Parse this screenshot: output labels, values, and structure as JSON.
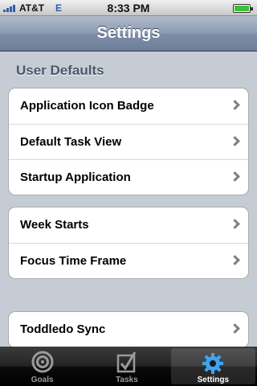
{
  "status": {
    "carrier": "AT&T",
    "network": "E",
    "time": "8:33 PM"
  },
  "nav": {
    "title": "Settings"
  },
  "sections": [
    {
      "header": "User Defaults",
      "rows": [
        "Application Icon Badge",
        "Default Task View",
        "Startup Application"
      ]
    },
    {
      "rows": [
        "Week Starts",
        "Focus Time Frame"
      ]
    },
    {
      "rows": [
        "Toddledo Sync"
      ]
    }
  ],
  "tabs": [
    {
      "label": "Goals",
      "icon": "target-icon"
    },
    {
      "label": "Tasks",
      "icon": "checkbox-icon"
    },
    {
      "label": "Settings",
      "icon": "gear-icon",
      "active": true
    }
  ]
}
